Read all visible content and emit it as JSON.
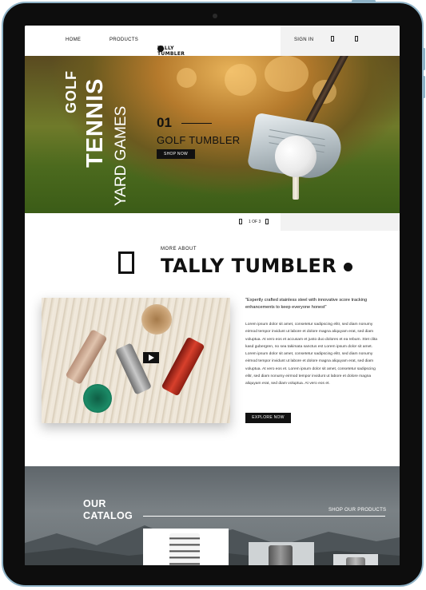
{
  "nav": {
    "home": "HOME",
    "products": "PRODUCTS",
    "logo": "TALLY TUMBLER",
    "sign_in": "SIGN IN"
  },
  "hero": {
    "vertical_words": [
      "GOLF",
      "TENNIS",
      "YARD GAMES"
    ],
    "number": "01",
    "title": "GOLF TUMBLER",
    "button": "SHOP NOW"
  },
  "slider": {
    "counter": "1 OF 3"
  },
  "about": {
    "eyebrow": "MORE ABOUT",
    "brand": "TALLY TUMBLER",
    "quote": "\"Expertly crafted stainless steel with innovative score tracking enhancements to keep everyone honest\"",
    "body": "Lorem ipsum dolor sit amet, consetetur sadipscing elitr, sed diam nonumy eirmod tempor invidunt ut labore et dolore magna aliquyam erat, sed diam voluptua. At vero eos et accusam et justo duo dolores et ea rebum. Stet clita kasd gubergren, no sea takimata sanctus est Lorem ipsum dolor sit amet. Lorem ipsum dolor sit amet, consetetur sadipscing elitr, sed diam nonumy eirmod tempor invidunt ut labore et dolore magna aliquyam erat, sed diam voluptua. At vero eos et. Lorem ipsum dolor sit amet, consetetur sadipscing elitr, sed diam nonumy eirmod tempor invidunt ut labore et dolore magna aliquyam erat, sed diam voluptua. At vero eos et.",
    "button": "EXPLORE NOW"
  },
  "catalog": {
    "title_line1": "OUR",
    "title_line2": "CATALOG",
    "link": "SHOP OUR PRODUCTS"
  },
  "colors": {
    "device_frame": "#8fb3c7",
    "dark": "#111111",
    "nav_grey": "#f2f2f2"
  },
  "icons": [
    "user-icon",
    "cart-icon",
    "prev-arrow-icon",
    "next-arrow-icon",
    "play-icon",
    "golf-ball-icon"
  ]
}
